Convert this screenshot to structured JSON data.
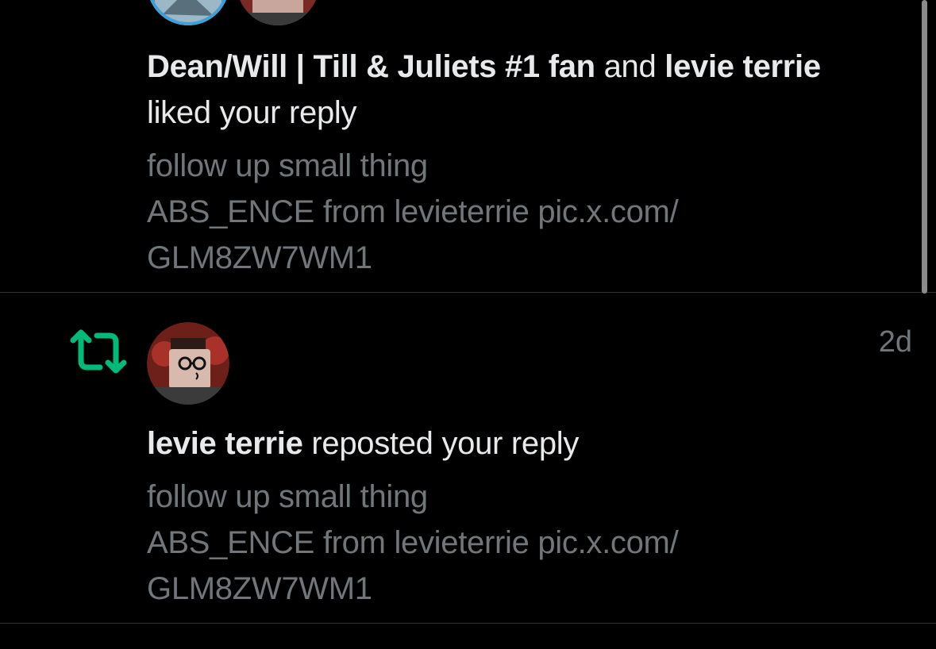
{
  "notifications": [
    {
      "type": "like",
      "user1": "Dean/Will | Till & Juliets #1 fan",
      "joiner": " and ",
      "user2": "levie terrie",
      "action": "liked your reply",
      "preview_lines": [
        "follow up small thing",
        "ABS_ENCE from levieterrie pic.x.com/",
        "GLM8ZW7WM1"
      ]
    },
    {
      "type": "repost",
      "timestamp": "2d",
      "user": "levie terrie",
      "action": " reposted your reply",
      "preview_lines": [
        "follow up small thing",
        "ABS_ENCE from levieterrie pic.x.com/",
        "GLM8ZW7WM1"
      ],
      "icon": "repost-icon",
      "icon_color": "#00ba7c"
    }
  ],
  "colors": {
    "background": "#000000",
    "primary_text": "#e7e9ea",
    "secondary_text": "#71767b",
    "divider": "#2f3336",
    "repost_green": "#00ba7c"
  }
}
